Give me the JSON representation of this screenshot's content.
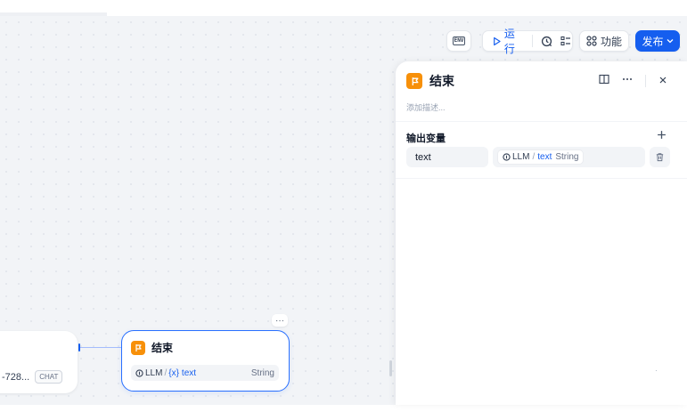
{
  "toolbar": {
    "env_icon_text": "ENV",
    "run_label": "运行",
    "feature_label": "功能",
    "publish_label": "发布",
    "icons": [
      "env-icon",
      "play-icon",
      "history-icon",
      "checklist-icon",
      "features-icon",
      "chevron-down-icon"
    ]
  },
  "canvas": {
    "left_node": {
      "truncated_model": "-728...",
      "badge": "CHAT"
    },
    "end_node": {
      "title": "结束",
      "more": "···",
      "variable": {
        "source": "LLM",
        "separator": "/",
        "name_prefix": "{x}",
        "name": "text",
        "type": "String"
      }
    }
  },
  "panel": {
    "title": "结束",
    "description_placeholder": "添加描述...",
    "section_title": "输出变量",
    "output": {
      "name": "text",
      "source": "LLM",
      "separator": "/",
      "variable": "text",
      "type": "String"
    },
    "corner_mark": "·",
    "icons": [
      "end-node-icon",
      "split-view-icon",
      "more-icon",
      "close-icon",
      "add-icon",
      "trash-icon"
    ]
  },
  "colors": {
    "accent": "#155eef",
    "end_node": "#f79009",
    "selected_border": "#2970ff"
  }
}
